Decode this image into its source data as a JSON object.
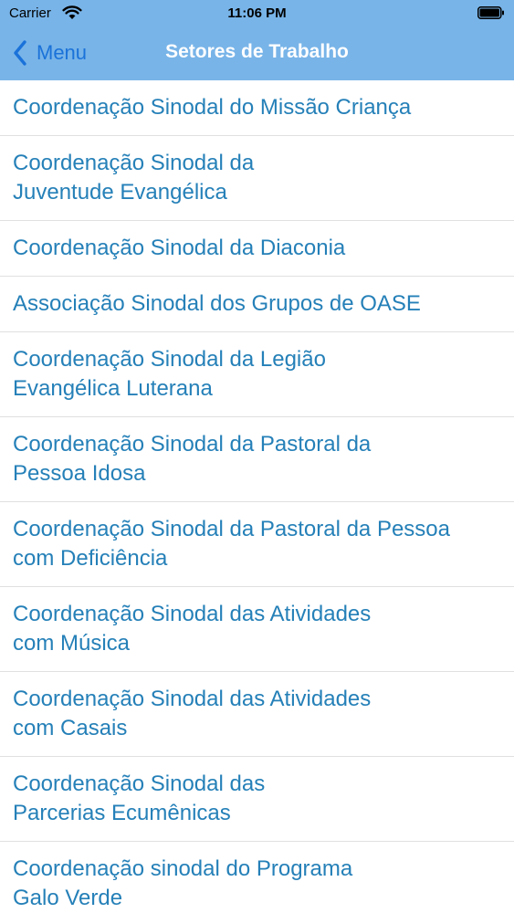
{
  "status_bar": {
    "carrier": "Carrier",
    "time": "11:06 PM",
    "wifi_icon": "wifi-icon",
    "battery_icon": "battery-icon"
  },
  "nav": {
    "back_label": "Menu",
    "back_icon": "chevron-left-icon",
    "title": "Setores de Trabalho"
  },
  "colors": {
    "nav_background": "#78b4e8",
    "back_button": "#1a72d9",
    "item_text": "#2580b8",
    "separator": "#e0e0e0"
  },
  "items": [
    {
      "lines": [
        "Coordenação Sinodal do Missão Criança"
      ]
    },
    {
      "lines": [
        "Coordenação Sinodal da",
        "Juventude Evangélica"
      ]
    },
    {
      "lines": [
        "Coordenação Sinodal da Diaconia"
      ]
    },
    {
      "lines": [
        "Associação Sinodal dos Grupos de OASE"
      ]
    },
    {
      "lines": [
        "Coordenação Sinodal da Legião",
        "Evangélica Luterana"
      ]
    },
    {
      "lines": [
        "Coordenação Sinodal da Pastoral da",
        "Pessoa Idosa"
      ]
    },
    {
      "lines": [
        "Coordenação Sinodal da Pastoral da Pessoa",
        "com Deficiência"
      ]
    },
    {
      "lines": [
        "Coordenação Sinodal das Atividades",
        "com Música"
      ]
    },
    {
      "lines": [
        "Coordenação Sinodal das Atividades",
        "com Casais"
      ]
    },
    {
      "lines": [
        "Coordenação Sinodal das",
        "Parcerias Ecumênicas"
      ]
    },
    {
      "lines": [
        "Coordenação sinodal do Programa",
        "Galo Verde"
      ]
    }
  ]
}
